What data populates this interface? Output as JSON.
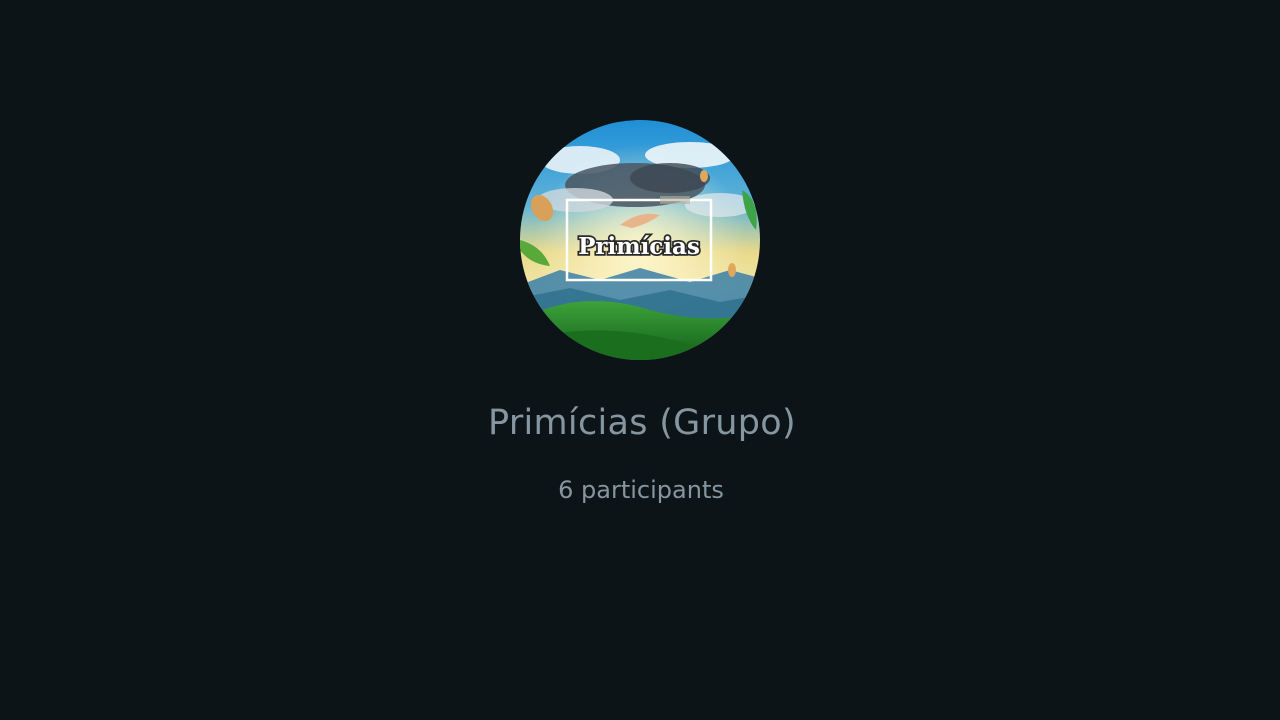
{
  "group": {
    "name": "Primícias (Grupo)",
    "participants_label": "6 participants",
    "avatar": {
      "icon": "group-avatar-icon",
      "logo_text": "Primícias"
    }
  },
  "colors": {
    "background": "#0d1418",
    "secondary_text": "#8596a0"
  }
}
